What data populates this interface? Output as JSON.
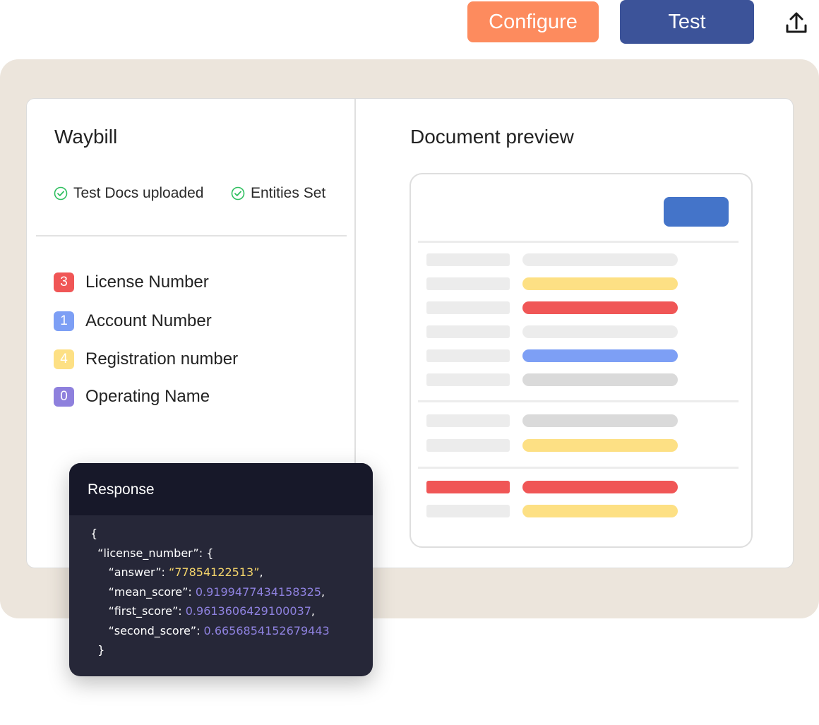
{
  "toolbar": {
    "configure_label": "Configure",
    "test_label": "Test",
    "upload_icon": "upload-icon"
  },
  "left_panel": {
    "title": "Waybill",
    "statuses": [
      {
        "label": "Test Docs uploaded",
        "icon": "check-circle-icon"
      },
      {
        "label": "Entities Set",
        "icon": "check-circle-icon"
      }
    ],
    "entities": [
      {
        "count": "3",
        "label": "License Number",
        "color": "#f05656"
      },
      {
        "count": "1",
        "label": "Account Number",
        "color": "#7d9ff5"
      },
      {
        "count": "4",
        "label": "Registration number",
        "color": "#fde084"
      },
      {
        "count": "0",
        "label": "Operating Name",
        "color": "#8e80dd"
      }
    ]
  },
  "preview": {
    "title": "Document preview",
    "accent": "#4474c9",
    "row_colors": [
      "#ececec",
      "#fde084",
      "#f05656",
      "#ececec",
      "#7d9ff5",
      "#dadada",
      "#dadada",
      "#fde084",
      "#f05656",
      "#fde084"
    ]
  },
  "response": {
    "title": "Response",
    "open_brace": "{",
    "key_line": "“license_number”: {",
    "answer_key": "“answer”: ",
    "answer_value": "“77854122513”",
    "mean_key": "“mean_score”: ",
    "mean_value": "0.9199477434158325",
    "first_key": "“first_score”: ",
    "first_value": "0.9613606429100037",
    "second_key": "“second_score”: ",
    "second_value": "0.6656854152679443",
    "close_brace": "}",
    "comma": ","
  }
}
